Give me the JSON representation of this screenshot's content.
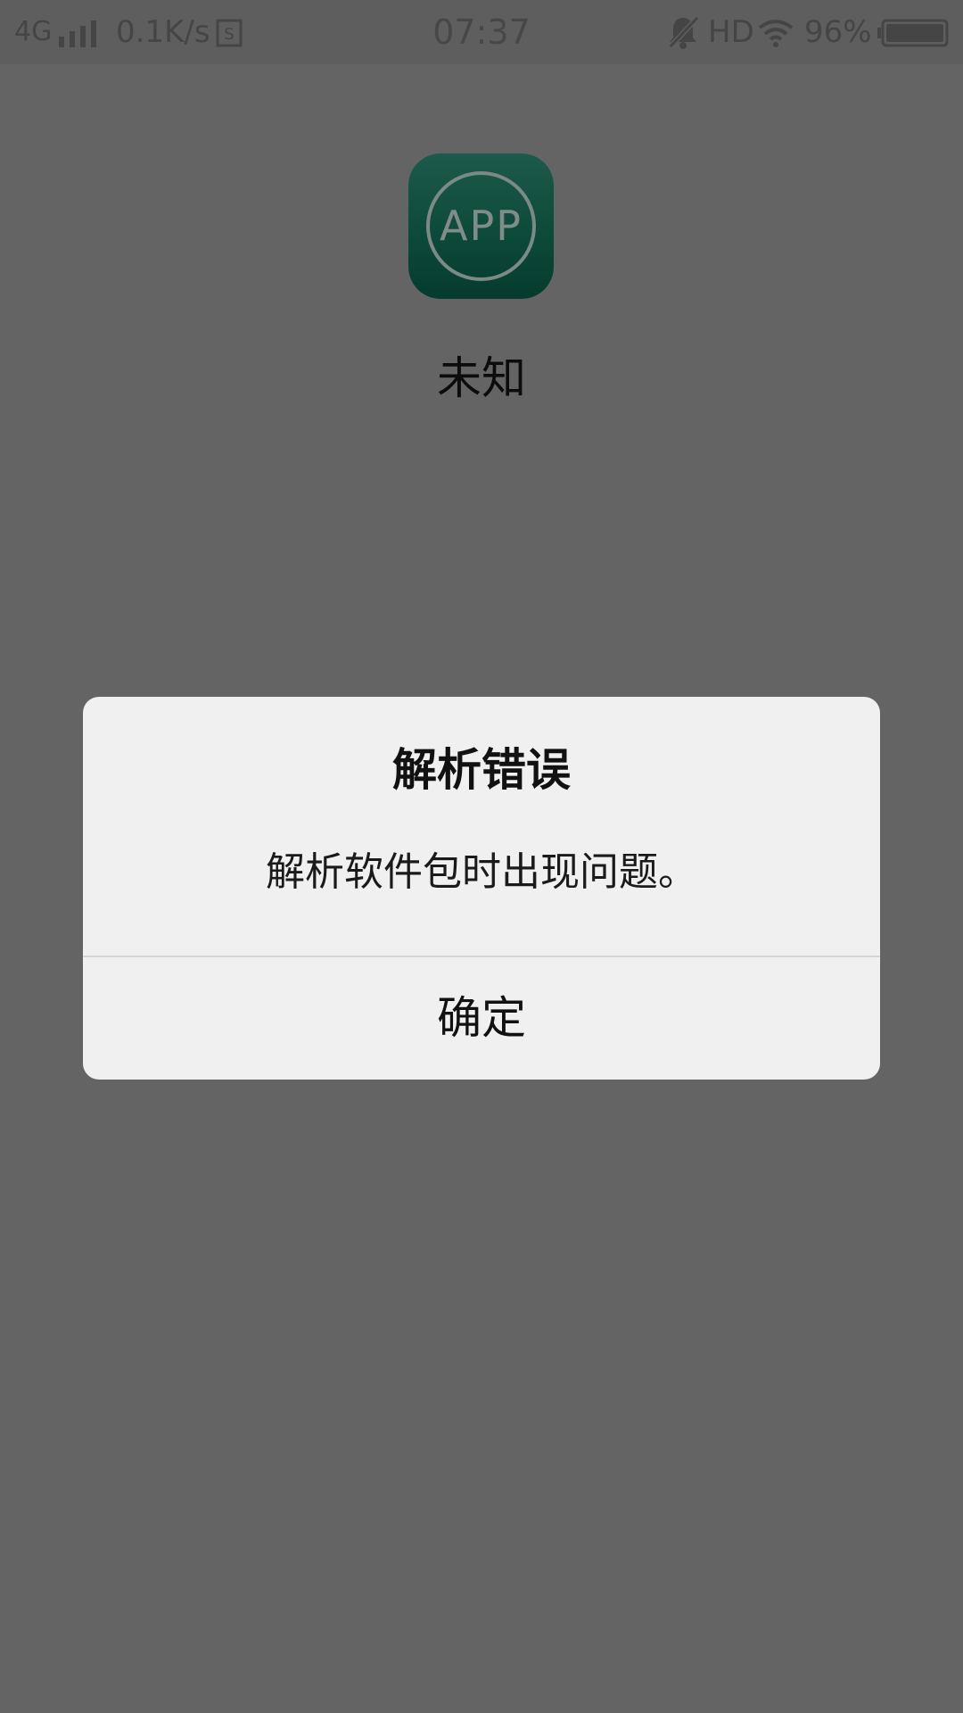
{
  "status_bar": {
    "network": "4G",
    "speed": "0.1K/s",
    "time": "07:37",
    "hd": "HD",
    "battery_percent": "96%",
    "icons": [
      "signal-icon",
      "sim-icon",
      "bell-off-icon",
      "wifi-icon",
      "battery-icon"
    ]
  },
  "app": {
    "icon_text": "APP",
    "name": "未知"
  },
  "dialog": {
    "title": "解析错误",
    "message": "解析软件包时出现问题。",
    "confirm_label": "确定"
  },
  "colors": {
    "background": "#646464",
    "dialog_background": "#f0f0f0",
    "app_icon_green": "#0d4a3c"
  }
}
